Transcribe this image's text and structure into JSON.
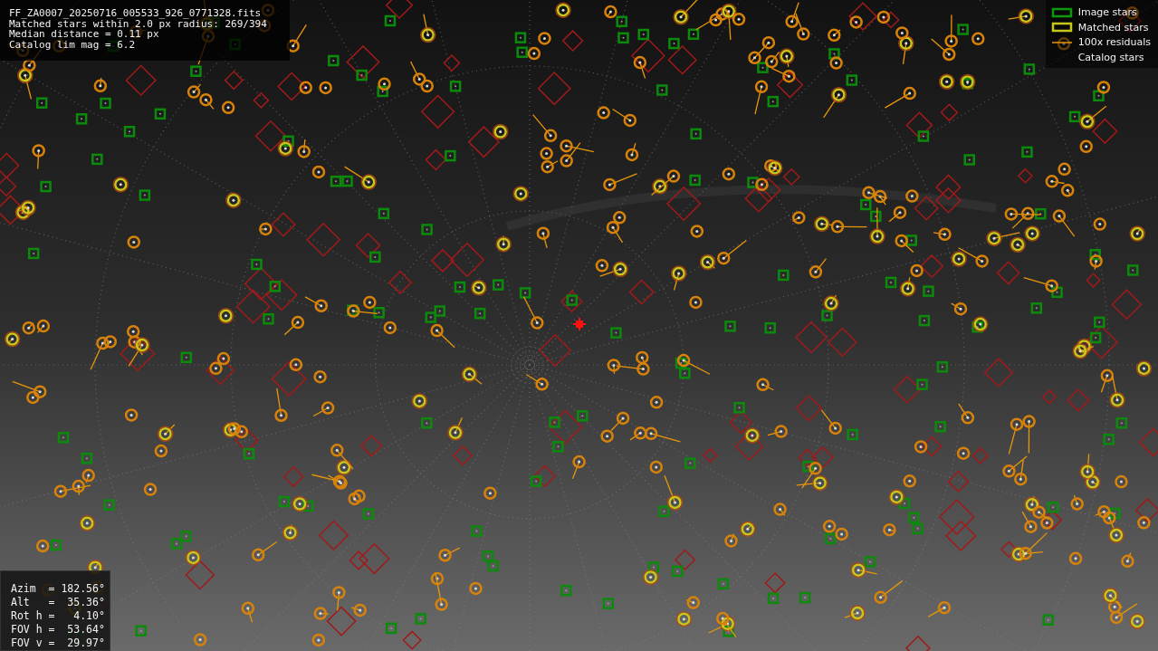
{
  "image_info": {
    "lines": [
      "FF_ZA0007_20250716_005533_926_0771328.fits",
      "Matched stars within 2.0 px radius: 269/394",
      "Median distance = 0.11 px",
      "Catalog lim mag = 6.2"
    ]
  },
  "legend": {
    "items": [
      {
        "label": "Image stars",
        "kind": "image"
      },
      {
        "label": "Matched stars",
        "kind": "matched"
      },
      {
        "label": "100x residuals",
        "kind": "residual"
      },
      {
        "label": "Catalog stars",
        "kind": "catalog"
      }
    ]
  },
  "pointing": {
    "lines": [
      "Azim  = 182.56°",
      "Alt   =  35.36°",
      "Rot h =   4.10°",
      "FOV h =  53.64°",
      "FOV v =  29.97°"
    ]
  }
}
